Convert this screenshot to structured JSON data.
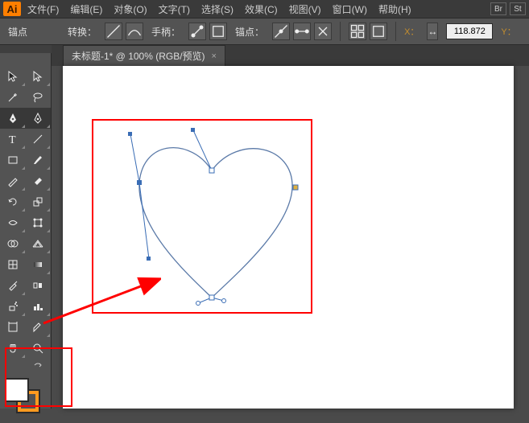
{
  "app_logo": "Ai",
  "menu": {
    "file": "文件(F)",
    "edit": "编辑(E)",
    "object": "对象(O)",
    "type": "文字(T)",
    "select": "选择(S)",
    "effect": "效果(C)",
    "view": "视图(V)",
    "window": "窗口(W)",
    "help": "帮助(H)"
  },
  "corner": {
    "br": "Br",
    "st": "St"
  },
  "options": {
    "anchor_label": "锚点",
    "convert_label": "转换：",
    "handles_label": "手柄：",
    "anchors_label": "锚点：",
    "x_label": "X：",
    "x_value": "118.872",
    "y_label": "Y："
  },
  "tab": {
    "title": "未标题-1* @ 100% (RGB/预览)",
    "close": "×"
  },
  "tools": {
    "selection": "selection-tool",
    "direct": "direct-selection-tool",
    "wand": "magic-wand-tool",
    "lasso": "lasso-tool",
    "pen": "pen-tool",
    "curvature": "curvature-tool",
    "type": "type-tool",
    "line": "line-segment-tool",
    "rect": "rectangle-tool",
    "brush": "paintbrush-tool",
    "pencil": "pencil-tool",
    "eraser": "eraser-tool",
    "rotate": "rotate-tool",
    "scale": "scale-tool",
    "width": "width-tool",
    "free": "free-transform-tool",
    "shape_builder": "shape-builder-tool",
    "perspective": "perspective-grid-tool",
    "mesh": "mesh-tool",
    "gradient": "gradient-tool",
    "eyedropper": "eyedropper-tool",
    "blend": "blend-tool",
    "symbol": "symbol-sprayer-tool",
    "graph": "column-graph-tool",
    "artboard": "artboard-tool",
    "slice": "slice-tool",
    "hand": "hand-tool",
    "zoom": "zoom-tool",
    "toggle": "swap-fill-stroke"
  },
  "colors": {
    "fill": "#ffffff",
    "stroke": "#ff9a1f"
  }
}
